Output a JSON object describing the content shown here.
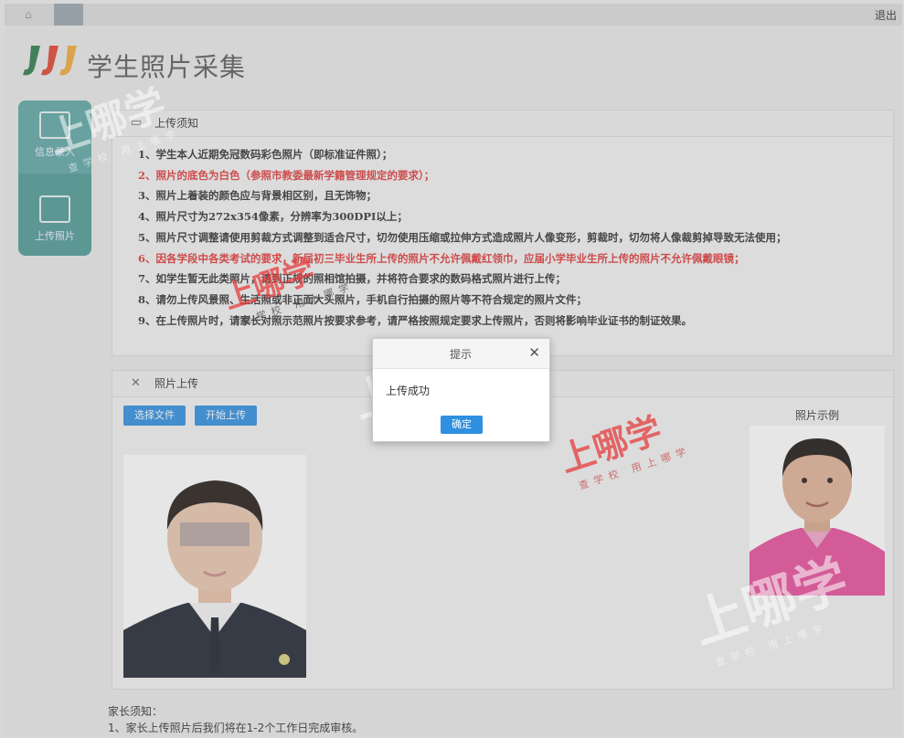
{
  "topbar": {
    "home_icon": "home-icon",
    "exit_label": "退出"
  },
  "header": {
    "title": "学生照片采集"
  },
  "sidebar": {
    "items": [
      {
        "label": "信息录入",
        "icon": "form-icon"
      },
      {
        "label": "上传照片",
        "icon": "image-icon"
      }
    ]
  },
  "notice": {
    "title": "上传须知",
    "items": [
      {
        "text": "1、学生本人近期免冠数码彩色照片（即标准证件照）；",
        "red": false
      },
      {
        "text": "2、照片的底色为白色（参照市教委最新学籍管理规定的要求）；",
        "red": true
      },
      {
        "text": "3、照片上着装的颜色应与背景相区别，且无饰物；",
        "red": false
      },
      {
        "text": "4、照片尺寸为272x354像素，分辨率为300DPI以上；",
        "red": false
      },
      {
        "text": "5、照片尺寸调整请使用剪裁方式调整到适合尺寸，切勿使用压缩或拉伸方式造成照片人像变形，剪裁时，切勿将人像裁剪掉导致无法使用；",
        "red": false
      },
      {
        "text": "6、因各学段中各类考试的要求，新届初三毕业生所上传的照片不允许佩戴红领巾，应届小学毕业生所上传的照片不允许佩戴眼镜；",
        "red": true
      },
      {
        "text": "7、如学生暂无此类照片，请到正规的照相馆拍摄，并将符合要求的数码格式照片进行上传；",
        "red": false
      },
      {
        "text": "8、请勿上传风景照、生活照或非正面大头照片，手机自行拍摄的照片等不符合规定的照片文件；",
        "red": false
      },
      {
        "text": "9、在上传照片时，请家长对照示范照片按要求参考，请严格按照规定要求上传照片，否则将影响毕业证书的制证效果。",
        "red": false
      }
    ]
  },
  "upload": {
    "title": "照片上传",
    "choose_button": "选择文件",
    "start_button": "开始上传",
    "example_label": "照片示例"
  },
  "parent_note": {
    "title": "家长须知：",
    "line1": "1、家长上传照片后我们将在1-2个工作日完成审核。"
  },
  "modal": {
    "title": "提示",
    "message": "上传成功",
    "ok_label": "确定"
  },
  "watermark": {
    "main": "上哪学",
    "sub": "查学校 用上哪学"
  },
  "colors": {
    "accent": "#2f8fe0",
    "sidebar": "#4f9a97",
    "warning": "#e03a3a"
  }
}
